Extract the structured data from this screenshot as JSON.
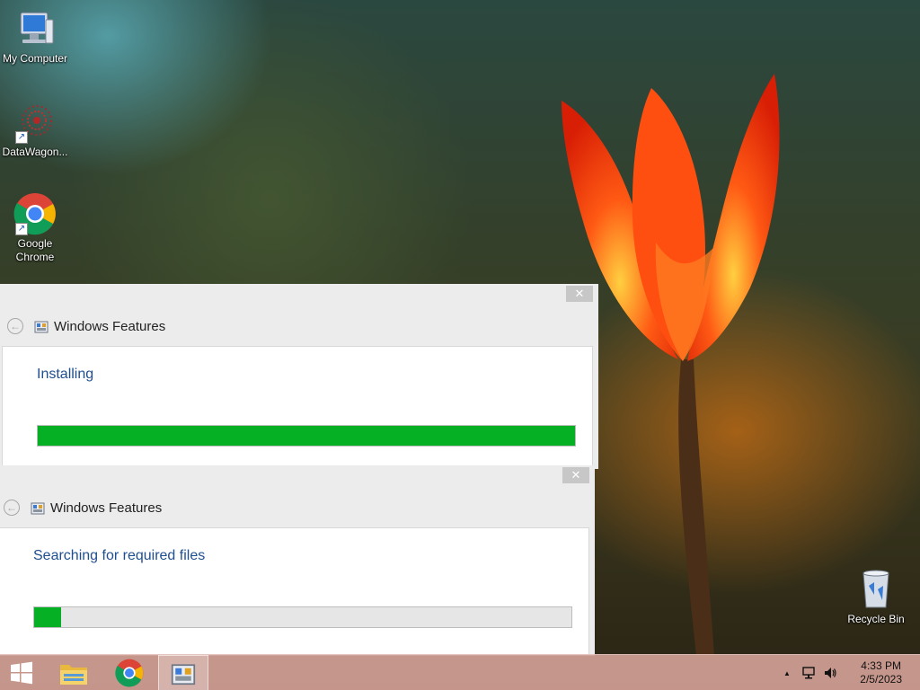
{
  "desktop": {
    "icons": [
      {
        "label": "My Computer",
        "icon": "computer-icon"
      },
      {
        "label": "DataWagon...",
        "icon": "datawagon-icon"
      },
      {
        "label": "Google Chrome",
        "icon": "chrome-icon"
      },
      {
        "label": "Recycle Bin",
        "icon": "recycle-bin-icon"
      }
    ]
  },
  "dialogs": [
    {
      "title": "Windows Features",
      "status": "Installing",
      "progress": 1.0,
      "close_label": "✕"
    },
    {
      "title": "Windows Features",
      "status": "Searching for required files",
      "progress": 0.05,
      "close_label": "✕"
    }
  ],
  "taskbar": {
    "items": [
      "start-icon",
      "file-explorer-icon",
      "chrome-icon",
      "windows-features-icon"
    ],
    "tray": {
      "show_hidden": "▲",
      "icons": [
        "network-icon",
        "volume-icon"
      ]
    },
    "clock": {
      "time": "4:33 PM",
      "date": "2/5/2023"
    }
  },
  "colors": {
    "progress": "#06b025",
    "status_text": "#1f4e8f"
  }
}
